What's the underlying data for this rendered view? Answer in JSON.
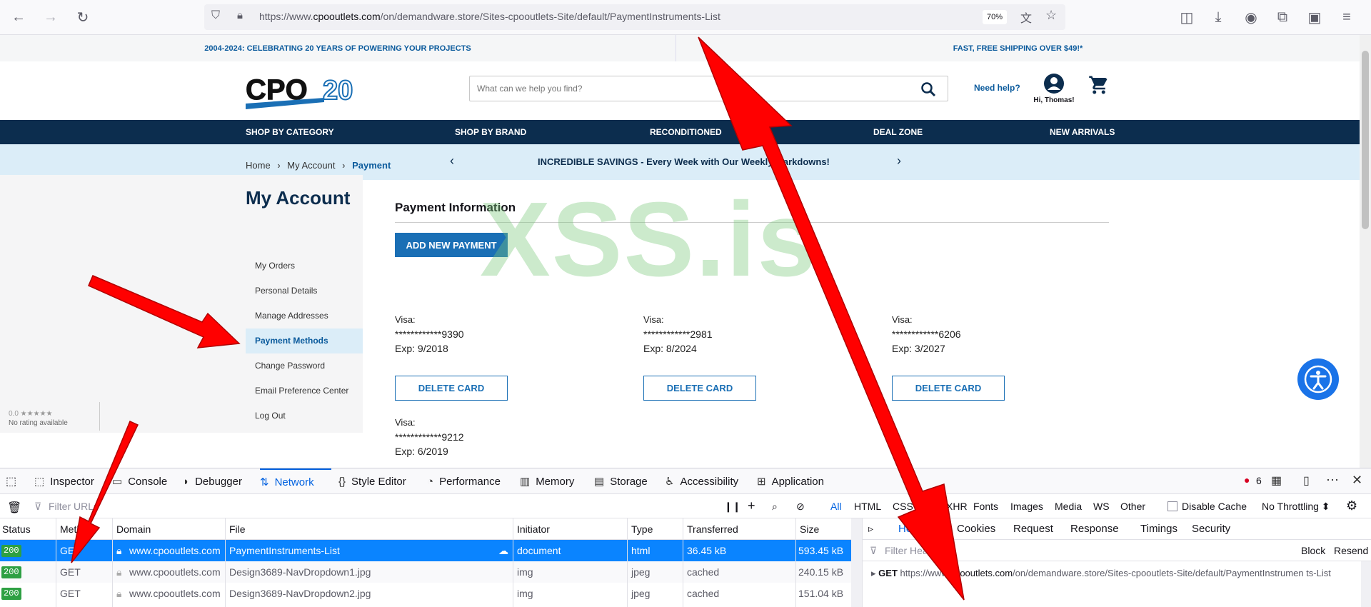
{
  "browser": {
    "url_prefix": "https://www.",
    "url_domain": "cpooutlets.com",
    "url_path": "/on/demandware.store/Sites-cpooutlets-Site/default/PaymentInstruments-List",
    "zoom": "70%"
  },
  "site": {
    "promo_left": "2004-2024: CELEBRATING 20 YEARS OF POWERING YOUR PROJECTS",
    "promo_right": "FAST, FREE SHIPPING OVER $49!*",
    "logo_text": "CPO",
    "logo_num": "20",
    "search_placeholder": "What can we help you find?",
    "need_help": "Need help?",
    "account_greeting": "Hi, Thomas!",
    "nav": [
      "SHOP BY CATEGORY",
      "SHOP BY BRAND",
      "RECONDITIONED",
      "DEAL ZONE",
      "NEW ARRIVALS"
    ],
    "banner": "INCREDIBLE SAVINGS - Every Week with Our Weekly Markdowns!",
    "breadcrumb": [
      "Home",
      "My Account",
      "Payment"
    ],
    "sidebar_title": "My Account",
    "sidebar": [
      "My Orders",
      "Personal Details",
      "Manage Addresses",
      "Payment Methods",
      "Change Password",
      "Email Preference Center",
      "Log Out"
    ],
    "rating_stars": "0.0 ★★★★★",
    "rating_text": "No rating available",
    "payment_title": "Payment Information",
    "add_payment": "ADD NEW PAYMENT",
    "delete_label": "DELETE CARD",
    "cards": [
      {
        "type": "Visa:",
        "number": "************9390",
        "exp": "Exp: 9/2018"
      },
      {
        "type": "Visa:",
        "number": "************2981",
        "exp": "Exp: 8/2024"
      },
      {
        "type": "Visa:",
        "number": "************6206",
        "exp": "Exp: 3/2027"
      },
      {
        "type": "Visa:",
        "number": "************9212",
        "exp": "Exp: 6/2019"
      }
    ],
    "watermark": "XSS.is"
  },
  "devtools": {
    "tabs": [
      "Inspector",
      "Console",
      "Debugger",
      "Network",
      "Style Editor",
      "Performance",
      "Memory",
      "Storage",
      "Accessibility",
      "Application"
    ],
    "error_count": "6",
    "filter_placeholder": "Filter URLs",
    "type_filters": [
      "All",
      "HTML",
      "CSS",
      "JS",
      "XHR",
      "Fonts",
      "Images",
      "Media",
      "WS",
      "Other"
    ],
    "disable_cache": "Disable Cache",
    "throttling": "No Throttling ⬍",
    "columns": [
      "Status",
      "Method",
      "Domain",
      "File",
      "Initiator",
      "Type",
      "Transferred",
      "Size"
    ],
    "rows": [
      {
        "status": "200",
        "method": "GET",
        "domain": "www.cpooutlets.com",
        "file": "PaymentInstruments-List",
        "initiator": "document",
        "type": "html",
        "transferred": "36.45 kB",
        "size": "593.45 kB"
      },
      {
        "status": "200",
        "method": "GET",
        "domain": "www.cpooutlets.com",
        "file": "Design3689-NavDropdown1.jpg",
        "initiator": "img",
        "type": "jpeg",
        "transferred": "cached",
        "size": "240.15 kB"
      },
      {
        "status": "200",
        "method": "GET",
        "domain": "www.cpooutlets.com",
        "file": "Design3689-NavDropdown2.jpg",
        "initiator": "img",
        "type": "jpeg",
        "transferred": "cached",
        "size": "151.04 kB"
      }
    ],
    "detail_tabs": [
      "Headers",
      "Cookies",
      "Request",
      "Response",
      "Timings",
      "Security"
    ],
    "filter_headers": "Filter Headers",
    "block": "Block",
    "resend": "Resend",
    "get_label": "GET",
    "get_url_prefix": "https://www.",
    "get_url_domain": "cpooutlets.com",
    "get_url_path": "/on/demandware.store/Sites-cpooutlets-Site/default/PaymentInstrumen ts-List"
  },
  "colors": {
    "accent": "#1a6fb5",
    "nav": "#0c2d4e",
    "arrow": "#ff0000",
    "selected_row": "#0a84ff"
  }
}
